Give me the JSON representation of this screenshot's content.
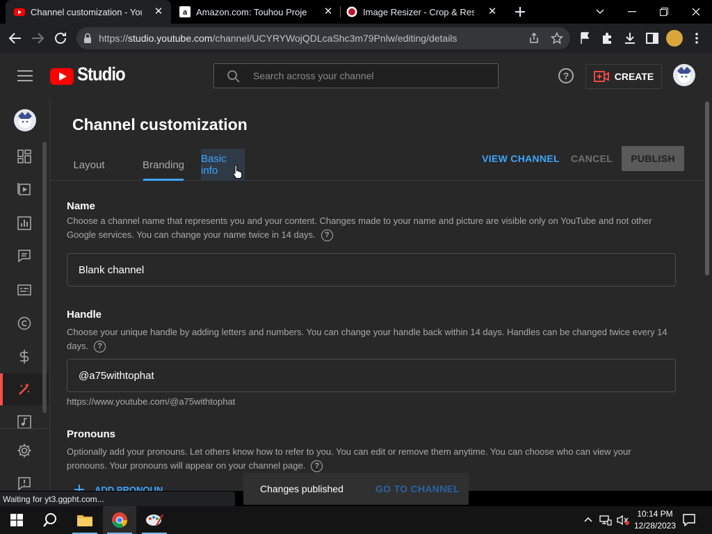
{
  "browser": {
    "tabs": [
      {
        "title": "Channel customization - YouTube Studio",
        "active": true
      },
      {
        "title": "Amazon.com: Touhou Project Plush",
        "active": false
      },
      {
        "title": "Image Resizer - Crop & Resize Images",
        "active": false
      }
    ],
    "url_scheme": "https://",
    "url_host": "studio.youtube.com",
    "url_path": "/channel/UCYRYWojQDLcaShc3m79Pnlw/editing/details",
    "status": "Waiting for yt3.ggpht.com..."
  },
  "header": {
    "logo_text": "Studio",
    "search_placeholder": "Search across your channel",
    "help_glyph": "?",
    "create_label": "CREATE"
  },
  "rail": {
    "items": [
      {
        "icon": "dashboard-icon"
      },
      {
        "icon": "content-icon"
      },
      {
        "icon": "analytics-icon"
      },
      {
        "icon": "comments-icon"
      },
      {
        "icon": "subtitles-icon"
      },
      {
        "icon": "copyright-icon"
      },
      {
        "icon": "earn-icon"
      },
      {
        "icon": "customization-icon",
        "active": true
      },
      {
        "icon": "audio-library-icon"
      },
      {
        "icon": "settings-icon"
      },
      {
        "icon": "feedback-icon"
      }
    ]
  },
  "page": {
    "title": "Channel customization",
    "tabs": [
      "Layout",
      "Branding",
      "Basic info"
    ],
    "selected_tab": "Basic info",
    "view_channel": "VIEW CHANNEL",
    "cancel": "CANCEL",
    "publish": "PUBLISH"
  },
  "name_section": {
    "heading": "Name",
    "description": "Choose a channel name that represents you and your content. Changes made to your name and picture are visible only on YouTube and not other Google services. You can change your name twice in 14 days.",
    "value": "Blank channel"
  },
  "handle_section": {
    "heading": "Handle",
    "description": "Choose your unique handle by adding letters and numbers. You can change your handle back within 14 days. Handles can be changed twice every 14 days.",
    "value": "@a75withtophat",
    "url": "https://www.youtube.com/@a75withtophat"
  },
  "pronouns_section": {
    "heading": "Pronouns",
    "description": "Optionally add your pronouns. Let others know how to refer to you. You can edit or remove them anytime. You can choose who can view your pronouns. Your pronouns will appear on your channel page.",
    "add_label": "ADD PRONOUN"
  },
  "snackbar": {
    "message": "Changes published",
    "action": "GO TO CHANNEL"
  },
  "taskbar": {
    "time": "10:14 PM",
    "date": "12/28/2023"
  },
  "colors": {
    "accent_blue": "#3ea6ff",
    "youtube_red": "#ff0000",
    "active_rail": "#ff4e45",
    "surface": "#282828"
  }
}
